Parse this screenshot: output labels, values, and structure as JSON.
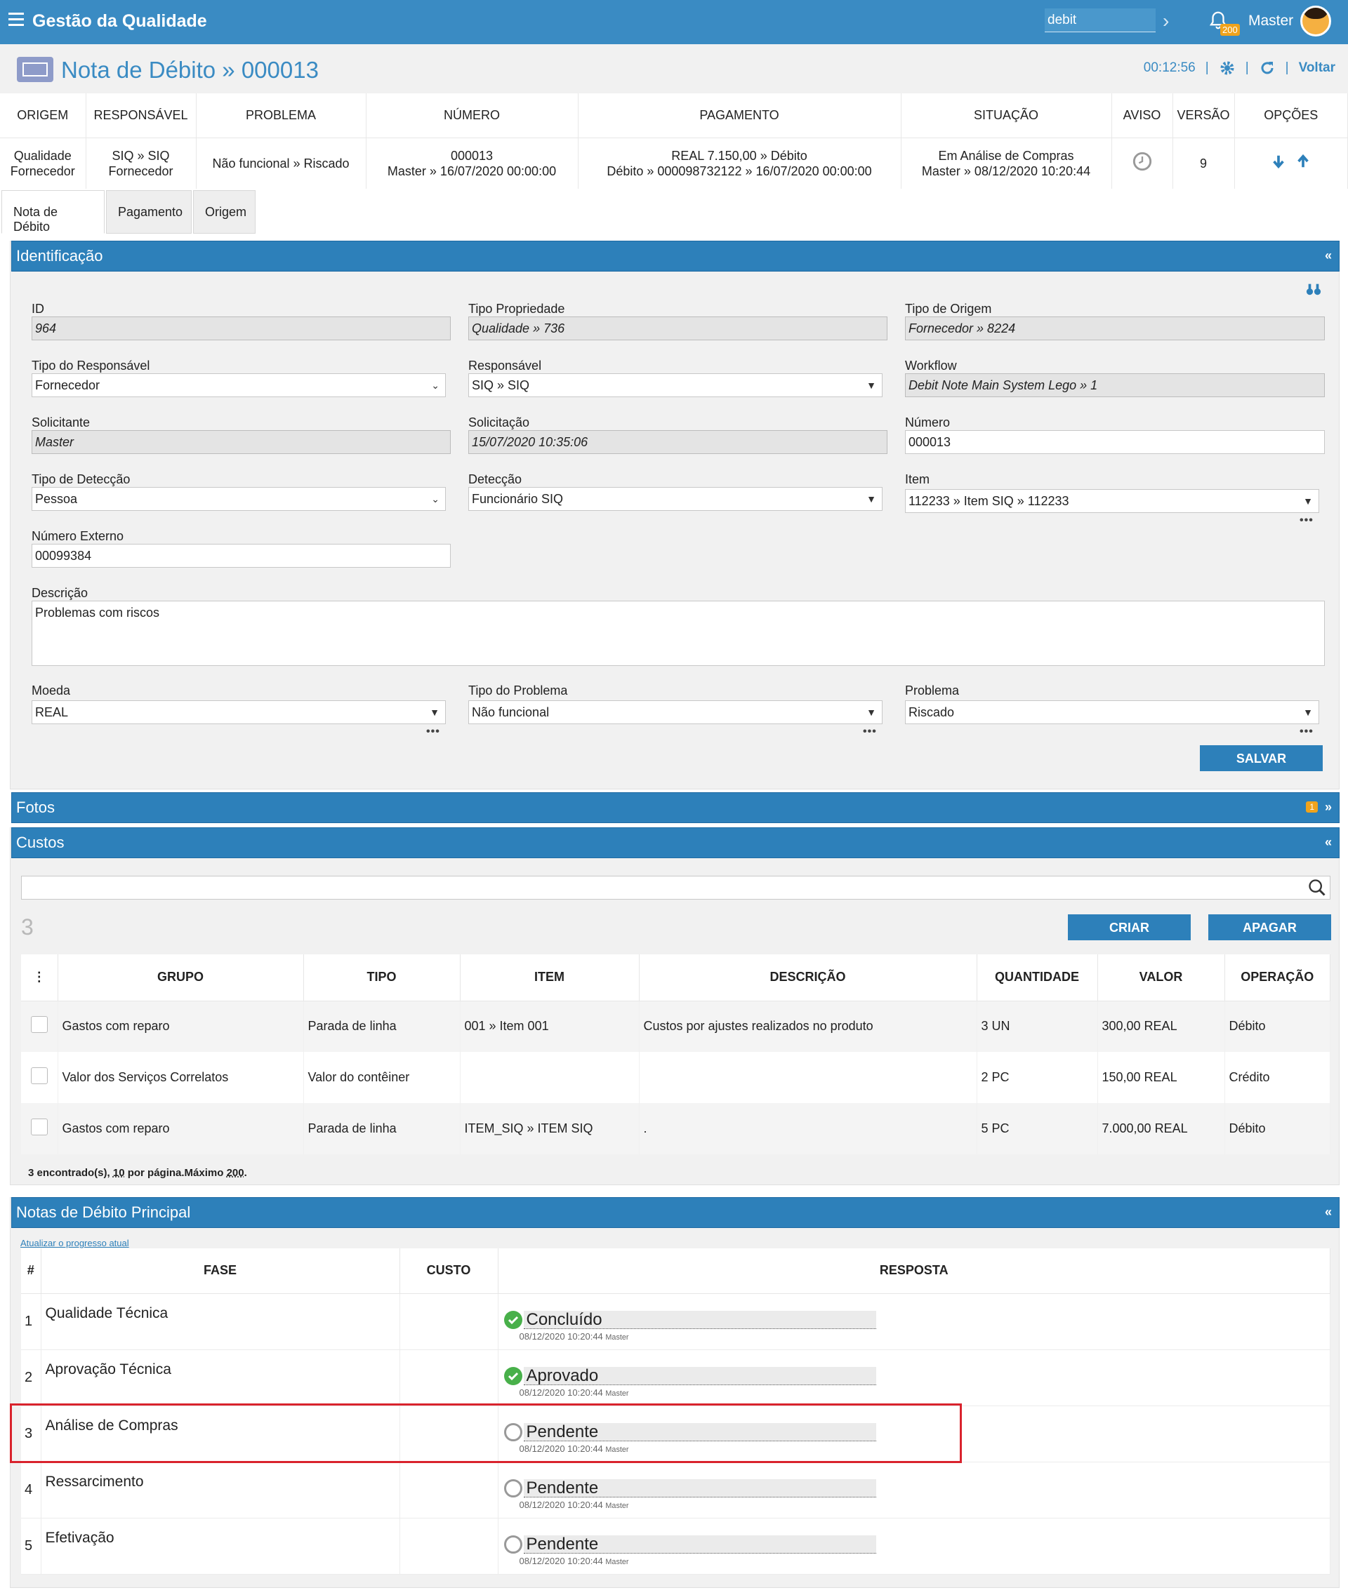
{
  "app": {
    "title": "Gestão da Qualidade",
    "search_value": "debit",
    "notifications": "200",
    "user": "Master"
  },
  "page": {
    "title": "Nota de Débito » 000013",
    "timer": "00:12:56",
    "back_label": "Voltar"
  },
  "summary": {
    "headers": [
      "ORIGEM",
      "RESPONSÁVEL",
      "PROBLEMA",
      "NÚMERO",
      "PAGAMENTO",
      "SITUAÇÃO",
      "AVISO",
      "VERSÃO",
      "OPÇÕES"
    ],
    "origem": [
      "Qualidade",
      "Fornecedor"
    ],
    "responsavel": [
      "SIQ » SIQ",
      "Fornecedor"
    ],
    "problema": "Não funcional » Riscado",
    "numero": [
      "000013",
      "Master » 16/07/2020 00:00:00"
    ],
    "pagamento": [
      "REAL 7.150,00 » Débito",
      "Débito » 000098732122 » 16/07/2020 00:00:00"
    ],
    "situacao": [
      "Em Análise de Compras",
      "Master » 08/12/2020 10:20:44"
    ],
    "versao": "9"
  },
  "tabs": [
    "Nota de Débito",
    "Pagamento",
    "Origem"
  ],
  "identificacao": {
    "title": "Identificação",
    "id_label": "ID",
    "id_value": "964",
    "tipo_prop_label": "Tipo Propriedade",
    "tipo_prop_value": "Qualidade » 736",
    "tipo_origem_label": "Tipo de Origem",
    "tipo_origem_value": "Fornecedor » 8224",
    "tipo_resp_label": "Tipo do Responsável",
    "tipo_resp_value": "Fornecedor",
    "resp_label": "Responsável",
    "resp_value": "SIQ » SIQ",
    "workflow_label": "Workflow",
    "workflow_value": "Debit Note Main System Lego » 1",
    "solicitante_label": "Solicitante",
    "solicitante_value": "Master",
    "solicitacao_label": "Solicitação",
    "solicitacao_value": "15/07/2020 10:35:06",
    "numero_label": "Número",
    "numero_value": "000013",
    "tipo_det_label": "Tipo de Detecção",
    "tipo_det_value": "Pessoa",
    "deteccao_label": "Detecção",
    "deteccao_value": "Funcionário SIQ",
    "item_label": "Item",
    "item_value": "112233 » Item SIQ » 112233",
    "num_ext_label": "Número Externo",
    "num_ext_value": "00099384",
    "descricao_label": "Descrição",
    "descricao_value": "Problemas com riscos",
    "moeda_label": "Moeda",
    "moeda_value": "REAL",
    "tipo_prob_label": "Tipo do Problema",
    "tipo_prob_value": "Não funcional",
    "problema_label": "Problema",
    "problema_value": "Riscado",
    "save_label": "SALVAR"
  },
  "fotos": {
    "title": "Fotos",
    "badge": "1"
  },
  "custos": {
    "title": "Custos",
    "count": "3",
    "create_label": "CRIAR",
    "delete_label": "APAGAR",
    "headers": [
      "GRUPO",
      "TIPO",
      "ITEM",
      "DESCRIÇÃO",
      "QUANTIDADE",
      "VALOR",
      "OPERAÇÃO"
    ],
    "rows": [
      {
        "grupo": "Gastos com reparo",
        "tipo": "Parada de linha",
        "item": "001 » Item 001",
        "descricao": "Custos por ajustes realizados no produto",
        "quantidade": "3 UN",
        "valor": "300,00 REAL",
        "operacao": "Débito"
      },
      {
        "grupo": "Valor dos Serviços Correlatos",
        "tipo": "Valor do contêiner",
        "item": "",
        "descricao": "",
        "quantidade": "2 PC",
        "valor": "150,00 REAL",
        "operacao": "Crédito"
      },
      {
        "grupo": "Gastos com reparo",
        "tipo": "Parada de linha",
        "item": "ITEM_SIQ » ITEM SIQ",
        "descricao": ".",
        "quantidade": "5 PC",
        "valor": "7.000,00 REAL",
        "operacao": "Débito"
      }
    ],
    "footer_found": "3 encontrado(s), ",
    "footer_per_page": "10",
    "footer_mid": " por página.Máximo ",
    "footer_max": "200",
    "footer_end": "."
  },
  "notas": {
    "title": "Notas de Débito Principal",
    "refresh_link": "Atualizar o progresso atual",
    "headers": [
      "#",
      "FASE",
      "CUSTO",
      "RESPOSTA"
    ],
    "rows": [
      {
        "n": "1",
        "fase": "Qualidade Técnica",
        "resposta": "Concluído",
        "meta": "08/12/2020 10:20:44",
        "user": "Master",
        "status": "ok"
      },
      {
        "n": "2",
        "fase": "Aprovação Técnica",
        "resposta": "Aprovado",
        "meta": "08/12/2020 10:20:44",
        "user": "Master",
        "status": "ok"
      },
      {
        "n": "3",
        "fase": "Análise de Compras",
        "resposta": "Pendente",
        "meta": "08/12/2020 10:20:44",
        "user": "Master",
        "status": "pending"
      },
      {
        "n": "4",
        "fase": "Ressarcimento",
        "resposta": "Pendente",
        "meta": "08/12/2020 10:20:44",
        "user": "Master",
        "status": "pending"
      },
      {
        "n": "5",
        "fase": "Efetivação",
        "resposta": "Pendente",
        "meta": "08/12/2020 10:20:44",
        "user": "Master",
        "status": "pending"
      }
    ]
  },
  "colors": {
    "accent": "#3a8bc3",
    "panel_header": "#2d80ba",
    "success": "#48b04a",
    "highlight": "#d9232d",
    "badge": "#f0a31c"
  },
  "icons": [
    "menu-icon",
    "chevron-right-icon",
    "bell-icon",
    "gear-icon",
    "refresh-icon",
    "clock-icon",
    "arrow-down-icon",
    "arrow-up-icon",
    "binoculars-icon",
    "search-icon",
    "check-icon"
  ]
}
